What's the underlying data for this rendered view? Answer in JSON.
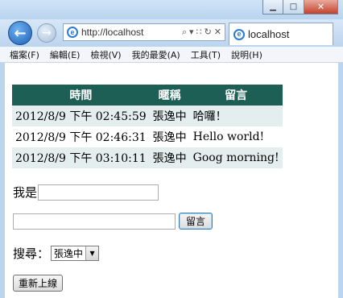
{
  "window": {
    "minimize_glyph": "▁",
    "maximize_glyph": "□",
    "close_glyph": "✕"
  },
  "navbar": {
    "back_glyph": "←",
    "forward_glyph": "→",
    "address": "http://localhost",
    "tab_title": "localhost"
  },
  "menu": {
    "items": [
      "檔案(F)",
      "編輯(E)",
      "檢視(V)",
      "我的最愛(A)",
      "工具(T)",
      "說明(H)"
    ]
  },
  "table": {
    "headers": [
      "時間",
      "暱稱",
      "留言"
    ],
    "rows": [
      [
        "2012/8/9 下午 02:45:59",
        "張逸中",
        "哈囉！"
      ],
      [
        "2012/8/9 下午 02:46:31",
        "張逸中",
        "Hello world!"
      ],
      [
        "2012/8/9 下午 03:10:11",
        "張逸中",
        "Goog morning!"
      ]
    ]
  },
  "form": {
    "name_label": "我是",
    "name_value": "",
    "message_value": "",
    "submit_label": "留言",
    "search_label": "搜尋：",
    "search_selected": "張逸中",
    "reconnect_label": "重新上線"
  },
  "colors": {
    "header_bg": "#1d5e55",
    "alt_row_bg": "#e4eeee"
  }
}
